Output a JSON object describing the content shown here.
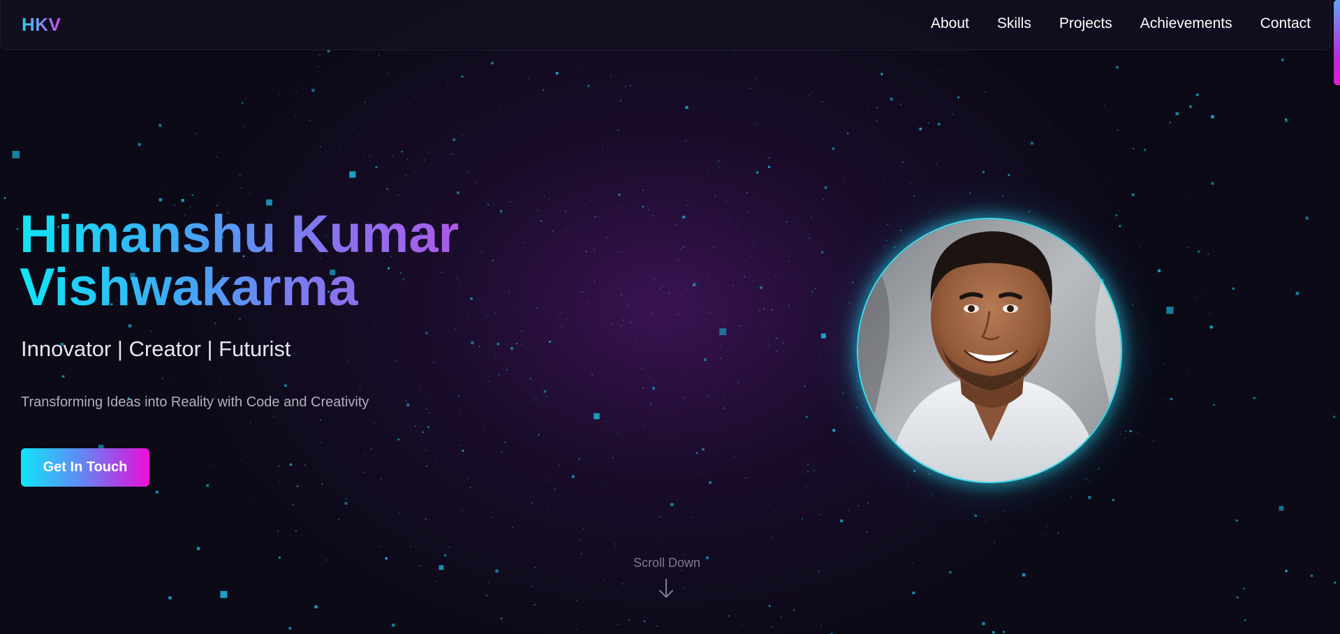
{
  "nav": {
    "logo": "HKV",
    "links": [
      "About",
      "Skills",
      "Projects",
      "Achievements",
      "Contact"
    ]
  },
  "hero": {
    "name_line1": "Himanshu Kumar",
    "name_line2": "Vishwakarma",
    "tagline": "Innovator | Creator | Futurist",
    "subtitle": "Transforming Ideas into Reality with Code and Creativity",
    "cta_label": "Get In Touch",
    "scroll_label": "Scroll Down"
  },
  "icons": {
    "scroll": "arrow-down-icon",
    "avatar": "profile-photo"
  },
  "colors": {
    "background": "#0b0a16",
    "accent_cyan": "#22d3ee",
    "accent_magenta": "#d946ef",
    "particle": "#1aa3c8"
  }
}
